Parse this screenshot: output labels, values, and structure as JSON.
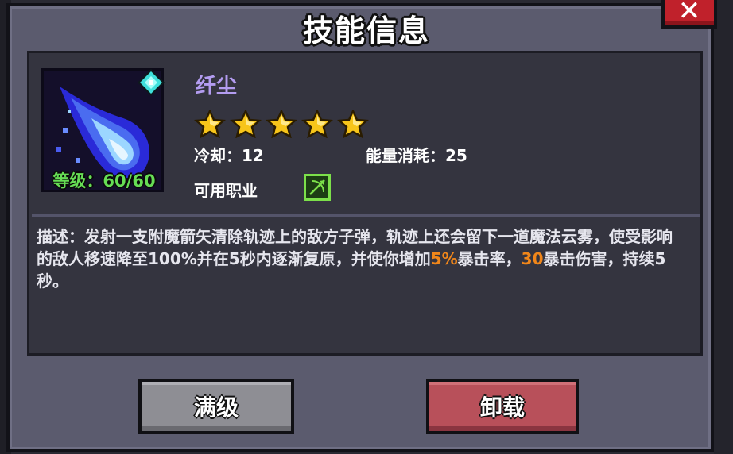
{
  "dialog": {
    "title": "技能信息",
    "close_label": "✕"
  },
  "skill": {
    "name": "纤尘",
    "star_count": 5,
    "level_label": "等级：60/60",
    "cooldown_label": "冷却：12",
    "energy_label": "能量消耗：25",
    "class_label": "可用职业",
    "desc_prefix": "描述：发射一支附魔箭矢清除轨迹上的敌方子弹，轨迹上还会留下一道魔法云雾，使受影响的敌人移速降至100%并在5秒内逐渐复原，并使你增加",
    "desc_hl1": "5%",
    "desc_mid": "暴击率，",
    "desc_hl2": "30",
    "desc_suffix": "暴击伤害，持续5秒。"
  },
  "buttons": {
    "max_level": "满级",
    "unload": "卸载"
  },
  "colors": {
    "panel": "#5b5b6e",
    "inner": "#34343f",
    "skill_name": "#b39cf0",
    "level_text": "#66dd55",
    "highlight": "#f0861a",
    "close_button": "#c0212b",
    "max_button": "#8e8e94",
    "unload_button": "#b8505a"
  },
  "icons": {
    "skill": "blue-flame-arrow-icon",
    "gem": "cyan-gem-icon",
    "star": "gold-star-icon",
    "class": "bow-class-icon"
  }
}
